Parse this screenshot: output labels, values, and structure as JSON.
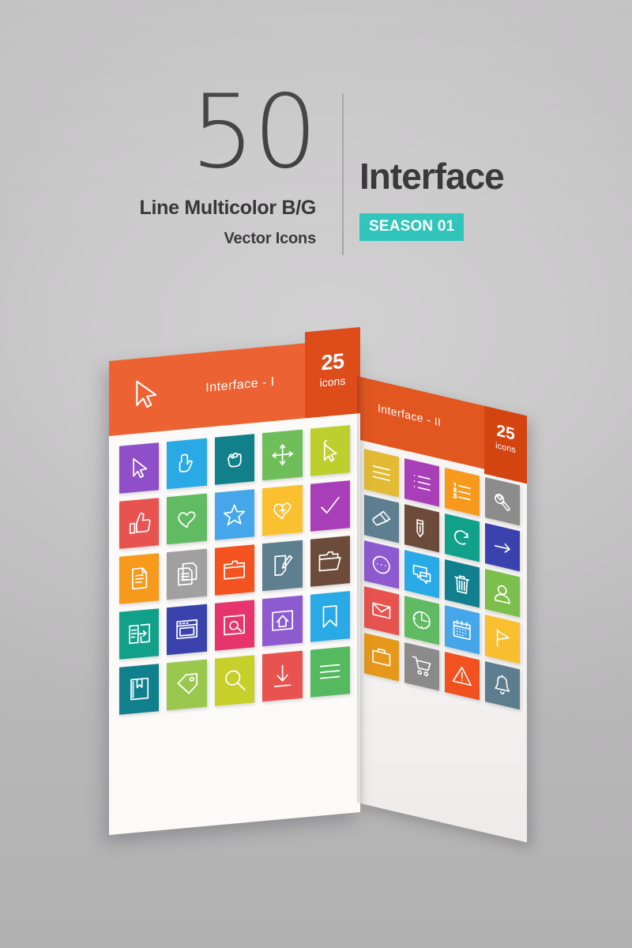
{
  "header": {
    "count": "50",
    "subtitle_1": "Line Multicolor B/G",
    "subtitle_2": "Vector Icons",
    "brand": "Interface",
    "season_badge": "SEASON 01"
  },
  "colors": {
    "background": "#c8c7c8",
    "panel_header_front": "#ec6233",
    "panel_header_back": "#e2561f",
    "badge_front": "#dd4c19",
    "badge_back": "#d34411",
    "season_badge": "#2fc4bb",
    "text_dark": "#343434",
    "panel_paper": "#fbfaf8"
  },
  "panels": [
    {
      "id": "interface-1",
      "title": "Interface - I",
      "badge_number": "25",
      "badge_label": "icons",
      "header_icon": "cursor-arrow-icon",
      "columns": 5,
      "tiles": [
        {
          "name": "cursor-arrow-icon",
          "color": "#8e4fc8"
        },
        {
          "name": "pointing-hand-icon",
          "color": "#29a9e6"
        },
        {
          "name": "grab-hand-icon",
          "color": "#12808a"
        },
        {
          "name": "move-arrows-icon",
          "color": "#6ebf5a"
        },
        {
          "name": "cursor-click-icon",
          "color": "#bccf2c"
        },
        {
          "name": "thumbs-up-icon",
          "color": "#e8534f"
        },
        {
          "name": "heart-icon",
          "color": "#61bb63"
        },
        {
          "name": "star-icon",
          "color": "#45a7ea"
        },
        {
          "name": "heart-plus-icon",
          "color": "#fac02f"
        },
        {
          "name": "checkmark-icon",
          "color": "#a93fb8"
        },
        {
          "name": "document-icon",
          "color": "#f79a1c"
        },
        {
          "name": "copy-documents-icon",
          "color": "#a0a0a0"
        },
        {
          "name": "folder-icon",
          "color": "#f4531f"
        },
        {
          "name": "edit-document-icon",
          "color": "#5e7f90"
        },
        {
          "name": "open-folder-icon",
          "color": "#6d4b3a"
        },
        {
          "name": "import-panel-icon",
          "color": "#11a18b"
        },
        {
          "name": "browser-window-icon",
          "color": "#3a43ad"
        },
        {
          "name": "search-box-icon",
          "color": "#e8346c"
        },
        {
          "name": "home-box-icon",
          "color": "#8e5ad0"
        },
        {
          "name": "bookmark-icon",
          "color": "#29a9e6"
        },
        {
          "name": "bookmarked-book-icon",
          "color": "#10808f"
        },
        {
          "name": "tag-icon",
          "color": "#95c council"
        },
        {
          "name": "magnifier-icon",
          "color": "#c7cf2b"
        },
        {
          "name": "download-icon",
          "color": "#e8534f"
        },
        {
          "name": "list-lines-icon",
          "color": "#55b95f"
        }
      ]
    },
    {
      "id": "interface-2",
      "title": "Interface - II",
      "badge_number": "25",
      "badge_label": "icons",
      "columns": 4,
      "tiles": [
        {
          "name": "lines-list-icon",
          "color": "#e3bb33"
        },
        {
          "name": "bullet-list-icon",
          "color": "#a93fb8"
        },
        {
          "name": "numbered-list-icon",
          "color": "#f79a1c"
        },
        {
          "name": "wrench-icon",
          "color": "#8c8c8c"
        },
        {
          "name": "paintbrush-icon",
          "color": "#5e7f90"
        },
        {
          "name": "pencil-icon",
          "color": "#6d4b3a"
        },
        {
          "name": "redo-arrow-icon",
          "color": "#11a18b"
        },
        {
          "name": "arrow-right-icon",
          "color": "#3a43ad"
        },
        {
          "name": "more-dots-icon",
          "color": "#8e5ad0"
        },
        {
          "name": "chat-bubbles-icon",
          "color": "#29a9e6"
        },
        {
          "name": "trash-icon",
          "color": "#10808f"
        },
        {
          "name": "user-icon",
          "color": "#7cbf4c"
        },
        {
          "name": "envelope-icon",
          "color": "#e8534f"
        },
        {
          "name": "clock-icon",
          "color": "#61bb63"
        },
        {
          "name": "calendar-icon",
          "color": "#45a7ea"
        },
        {
          "name": "flag-icon",
          "color": "#fac02f"
        },
        {
          "name": "briefcase-icon",
          "color": "#e8991a"
        },
        {
          "name": "shopping-cart-icon",
          "color": "#8c8c8c"
        },
        {
          "name": "warning-triangle-icon",
          "color": "#f4531f"
        },
        {
          "name": "bell-icon",
          "color": "#5e7f90"
        }
      ]
    }
  ]
}
